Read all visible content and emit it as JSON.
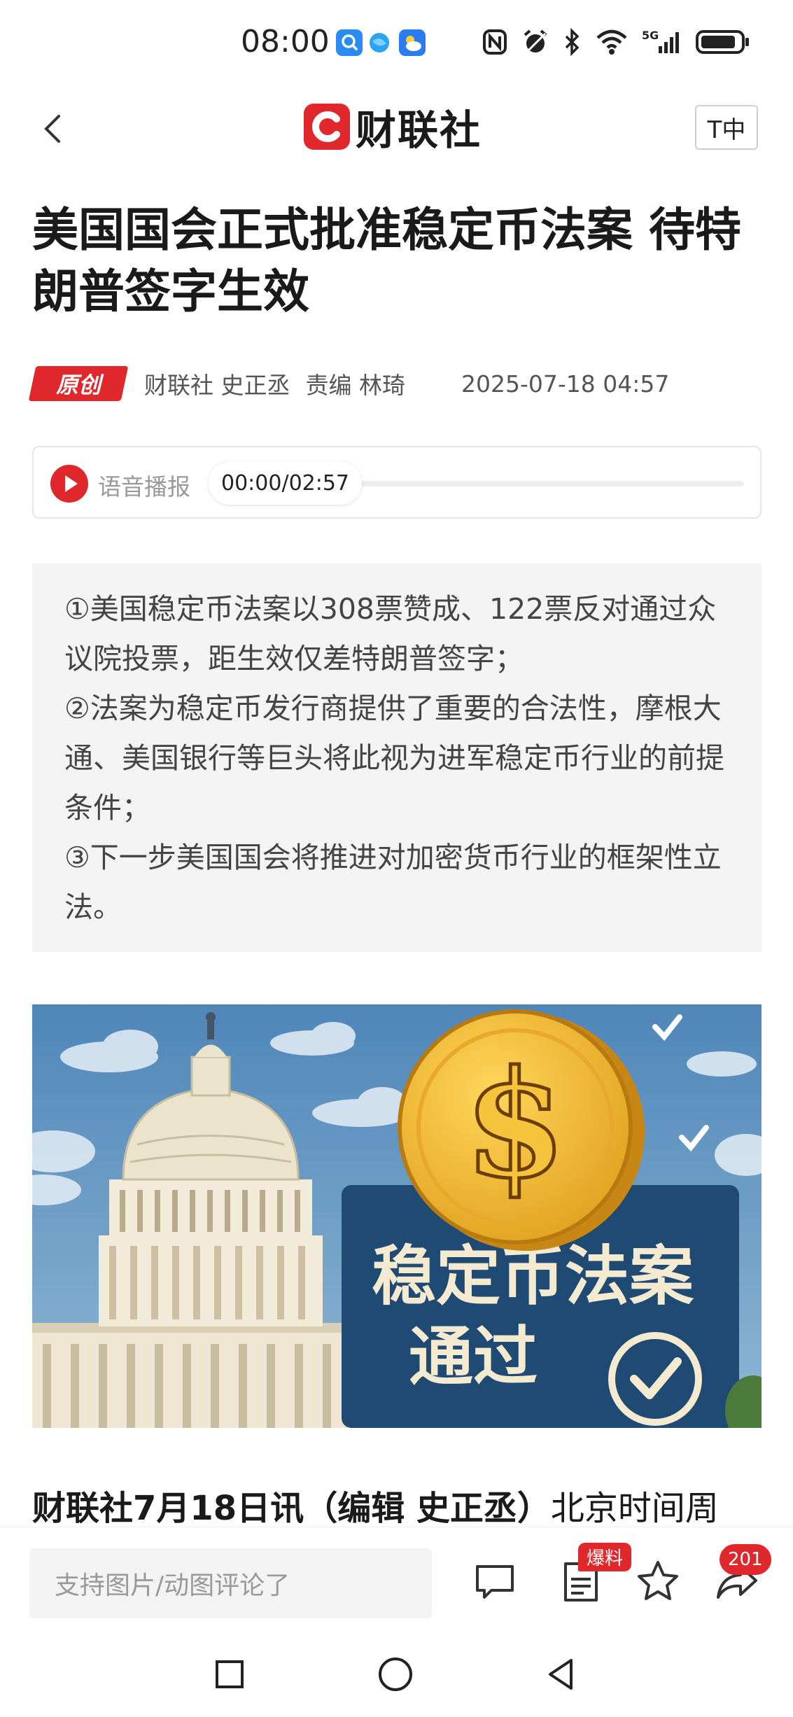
{
  "status_bar": {
    "time": "08:00",
    "app_icons": [
      "search-app-icon",
      "browser-app-icon",
      "weather-app-icon"
    ],
    "system_icons": [
      "nfc-icon",
      "alarm-icon",
      "bluetooth-icon",
      "wifi-icon",
      "5g-signal-icon",
      "battery-icon"
    ]
  },
  "header": {
    "logo_text": "财联社",
    "font_size_label": "T中"
  },
  "article": {
    "title": "美国国会正式批准稳定币法案 待特朗普签字生效",
    "badge": "原创",
    "author": "财联社 史正丞",
    "editor": "责编 林琦",
    "date": "2025-07-18 04:57"
  },
  "audio": {
    "label": "语音播报",
    "time": "00:00/02:57",
    "progress": 0
  },
  "summary": [
    "①美国稳定币法案以308票赞成、122票反对通过众议院投票，距生效仅差特朗普签字；",
    "②法案为稳定币发行商提供了重要的合法性，摩根大通、美国银行等巨头将此视为进军稳定币行业的前提条件；",
    "③下一步美国国会将推进对加密货币行业的框架性立法。"
  ],
  "hero_image": {
    "banner_line1": "稳定币法案",
    "banner_line2": "通过",
    "coin_symbol": "$"
  },
  "lead": {
    "bold": "财联社7月18日讯（编辑 史正丞）",
    "text": "北京时间周"
  },
  "bottom_bar": {
    "comment_placeholder": "支持图片/动图评论了",
    "baoliao_badge": "爆料",
    "share_count": "201"
  },
  "colors": {
    "brand_red": "#e0272b",
    "summary_bg": "#f4f4f4",
    "text_dark": "#1a1a1a"
  }
}
